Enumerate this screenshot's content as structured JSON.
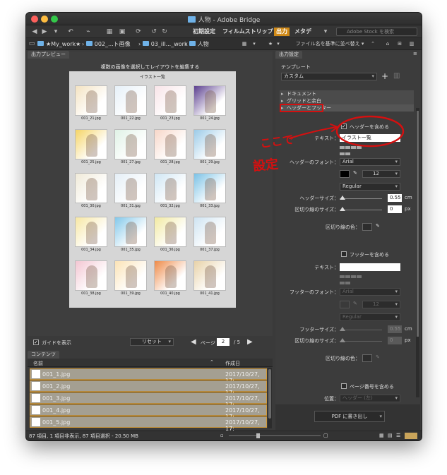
{
  "window": {
    "title": "人物 - Adobe Bridge"
  },
  "toolbar": {
    "workspaces": [
      "初期設定",
      "フィルムストリップ",
      "出力",
      "メタデ"
    ],
    "active_workspace": "出力",
    "search_placeholder": "Adobe Stock を検索"
  },
  "path": {
    "crumbs": [
      "★My_work★",
      "002_...ト画像",
      "03_ill..._work",
      "人物"
    ],
    "sort_label": "ファイル名を基準に並べ替え"
  },
  "preview": {
    "tab": "出力プレビュー",
    "header": "複数の画像を選択してレイアウトを編集する",
    "sheet_title": "イラスト一覧",
    "thumbs": [
      "001_21.jpg",
      "001_22.jpg",
      "001_23.jpg",
      "001_24.jpg",
      "001_25.jpg",
      "001_27.jpg",
      "001_28.jpg",
      "001_29.jpg",
      "001_30.jpg",
      "001_31.jpg",
      "001_32.jpg",
      "001_33.jpg",
      "001_34.jpg",
      "001_35.jpg",
      "001_36.jpg",
      "001_37.jpg",
      "001_38.jpg",
      "001_39.jpg",
      "001_40.jpg",
      "001_41.jpg"
    ],
    "show_guides": "ガイドを表示",
    "reset": "リセット",
    "page_label": "ページ",
    "page_current": "2",
    "page_total": "/ 5"
  },
  "content": {
    "tab": "コンテンツ",
    "col_name": "名前",
    "col_date": "作成日",
    "rows": [
      {
        "name": "001_1.jpg",
        "date": "2017/10/27, 17:"
      },
      {
        "name": "001_2.jpg",
        "date": "2017/10/27, 17:"
      },
      {
        "name": "001_3.jpg",
        "date": "2017/10/27, 17:"
      },
      {
        "name": "001_4.jpg",
        "date": "2017/10/27, 17:"
      },
      {
        "name": "001_5.jpg",
        "date": "2017/10/27, 17:"
      }
    ]
  },
  "status": {
    "text": "87 項目, 1 項目非表示, 87 項目選択 - 20.50 MB"
  },
  "output": {
    "tab": "出力設定",
    "template_label": "テンプレート",
    "template_value": "カスタム",
    "sections": [
      "ドキュメント",
      "グリッドと余白",
      "ヘッダーとフッター"
    ],
    "header": {
      "include": "ヘッダーを含める",
      "text_label": "テキスト：",
      "text_value": "イラスト一覧",
      "font_label": "ヘッダーのフォント：",
      "font": "Arial",
      "style": "Regular",
      "size_value": "12",
      "size_label": "ヘッダーサイズ：",
      "size": "0.55",
      "size_unit": "cm",
      "divider_label": "区切り線のサイズ：",
      "divider": "0",
      "divider_unit": "px",
      "divider_color_label": "区切り線の色："
    },
    "footer": {
      "include": "フッターを含める",
      "text_label": "テキスト：",
      "font_label": "フッターのフォント：",
      "font": "Arial",
      "style": "Regular",
      "size_value": "12",
      "size_label": "フッターサイズ：",
      "size": "0.55",
      "size_unit": "cm",
      "divider_label": "区切り線のサイズ：",
      "divider": "0",
      "divider_unit": "px",
      "divider_color_label": "区切り線の色："
    },
    "page_number": "ページ番号を含める",
    "position_label": "位置：",
    "position_value": "ヘッダー (左)",
    "export": "PDF に書き出し"
  },
  "annotation": {
    "text_line1": "ここで",
    "text_line2": "設定",
    "color": "#d41010"
  }
}
